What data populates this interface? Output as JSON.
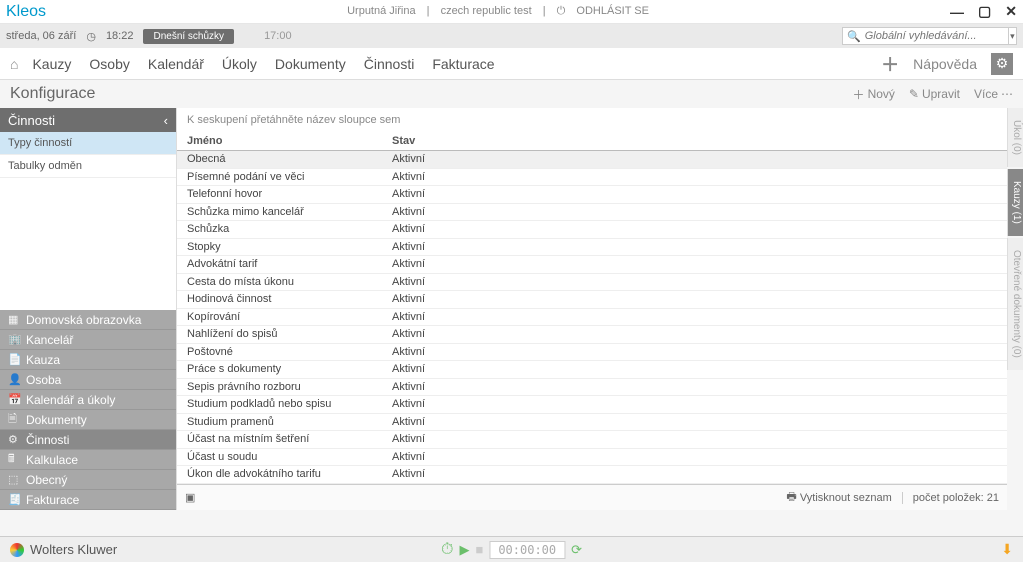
{
  "app": {
    "name": "Kleos"
  },
  "titlebar": {
    "user": "Urputná Jiřina",
    "org": "czech republic test",
    "logout_label": "ODHLÁSIT SE"
  },
  "infobar": {
    "date": "středa, 06 září",
    "clock": "18:22",
    "badge": "Dnešní schůzky",
    "time_value": "17:00",
    "search_placeholder": "Globální vyhledávání..."
  },
  "mainnav": {
    "items": [
      "Kauzy",
      "Osoby",
      "Kalendář",
      "Úkoly",
      "Dokumenty",
      "Činnosti",
      "Fakturace"
    ],
    "help": "Nápověda"
  },
  "pagehead": {
    "title": "Konfigurace",
    "new": "Nový",
    "edit": "Upravit",
    "more": "Více"
  },
  "sidebar": {
    "head": "Činnosti",
    "subs": [
      "Typy činností",
      "Tabulky odměn"
    ],
    "nav": [
      "Domovská obrazovka",
      "Kancelář",
      "Kauza",
      "Osoba",
      "Kalendář a úkoly",
      "Dokumenty",
      "Činnosti",
      "Kalkulace",
      "Obecný",
      "Fakturace"
    ],
    "active_nav_index": 6
  },
  "table": {
    "group_hint": "K seskupení přetáhněte název sloupce sem",
    "columns": [
      "Jméno",
      "Stav"
    ],
    "rows": [
      {
        "name": "Obecná",
        "status": "Aktivní",
        "selected": true
      },
      {
        "name": "Písemné podání ve věci",
        "status": "Aktivní"
      },
      {
        "name": "Telefonní hovor",
        "status": "Aktivní"
      },
      {
        "name": "Schůzka mimo kancelář",
        "status": "Aktivní"
      },
      {
        "name": "Schůzka",
        "status": "Aktivní"
      },
      {
        "name": "Stopky",
        "status": "Aktivní"
      },
      {
        "name": "Advokátní tarif",
        "status": "Aktivní"
      },
      {
        "name": "Cesta do místa úkonu",
        "status": "Aktivní"
      },
      {
        "name": "Hodinová činnost",
        "status": "Aktivní"
      },
      {
        "name": "Kopírování",
        "status": "Aktivní"
      },
      {
        "name": "Nahlížení do spisů",
        "status": "Aktivní"
      },
      {
        "name": "Poštovné",
        "status": "Aktivní"
      },
      {
        "name": "Práce s dokumenty",
        "status": "Aktivní"
      },
      {
        "name": "Sepis právního rozboru",
        "status": "Aktivní"
      },
      {
        "name": "Studium podkladů nebo spisu",
        "status": "Aktivní"
      },
      {
        "name": "Studium pramenů",
        "status": "Aktivní"
      },
      {
        "name": "Účast na místním šetření",
        "status": "Aktivní"
      },
      {
        "name": "Účast u soudu",
        "status": "Aktivní"
      },
      {
        "name": "Úkon dle advokátního tarifu",
        "status": "Aktivní"
      }
    ],
    "print_label": "Vytisknout seznam",
    "count_label": "počet položek: 21"
  },
  "rail": {
    "tabs": [
      {
        "label": "Úkol (0)"
      },
      {
        "label": "Kauzy (1)",
        "active": true
      },
      {
        "label": "Otevřené dokumenty (0)"
      }
    ]
  },
  "footer": {
    "company": "Wolters Kluwer",
    "timer": "00:00:00"
  }
}
